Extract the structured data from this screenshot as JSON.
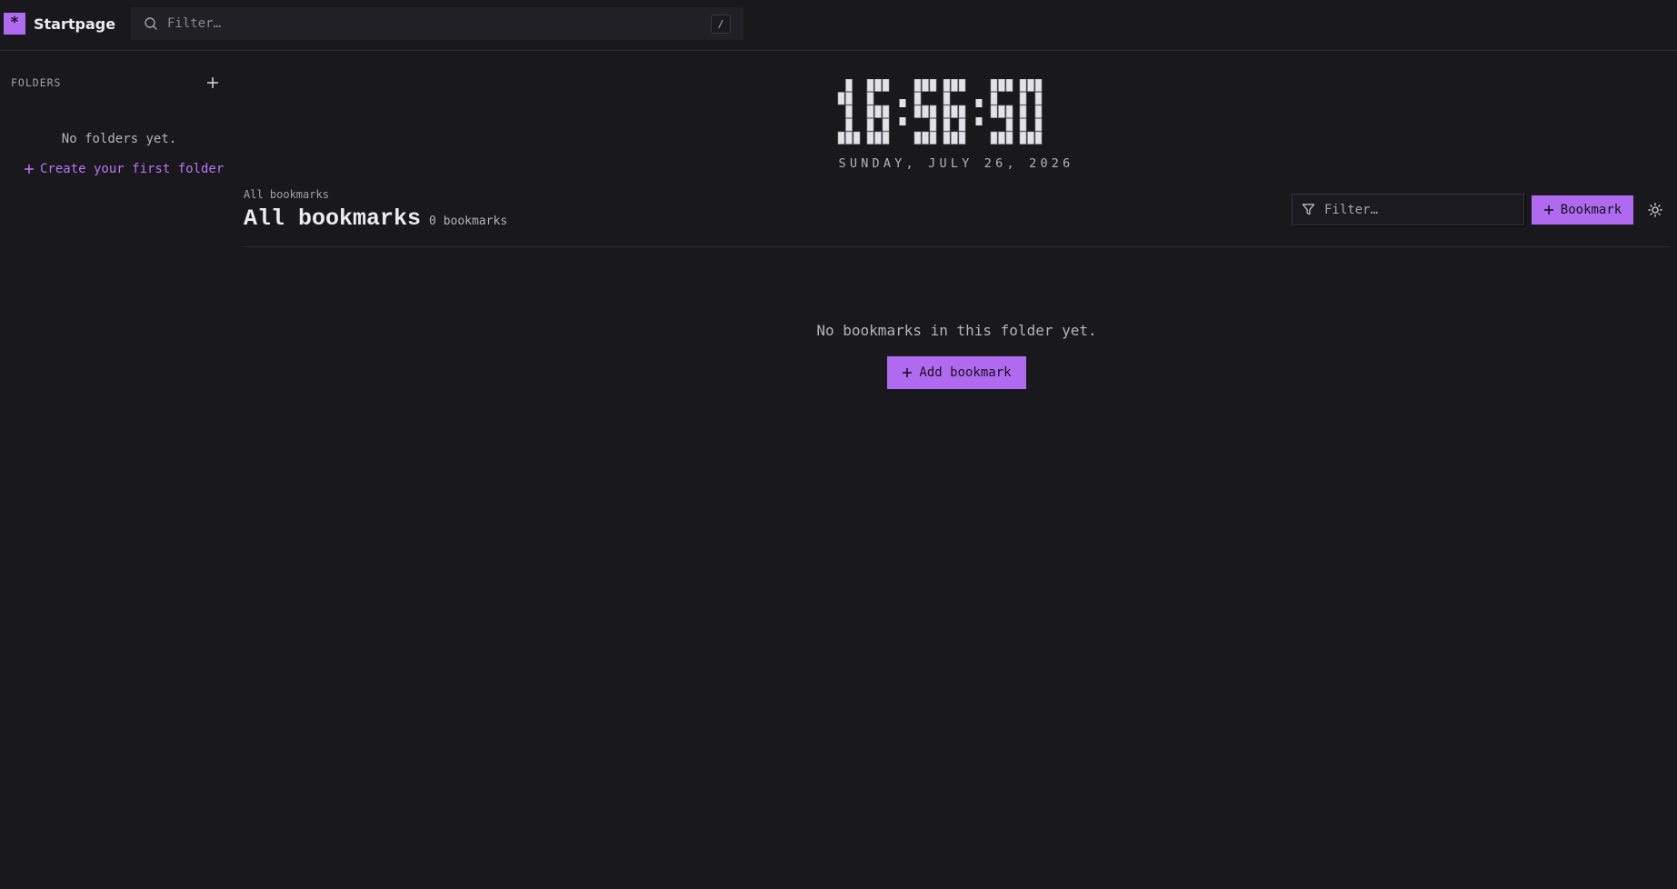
{
  "app": {
    "name": "Startpage",
    "logo_glyph": "*",
    "accent_color": "#b06af0"
  },
  "top_search": {
    "placeholder": "Filter…",
    "shortcut": "/",
    "icon": "search-icon"
  },
  "sidebar": {
    "section_label": "FOLDERS",
    "add_icon": "plus-icon",
    "empty_text": "No folders yet.",
    "create_link_label": "Create your first folder"
  },
  "clock": {
    "time": "16:56:50",
    "date": "SUNDAY, JULY 26, 2026"
  },
  "main": {
    "breadcrumb": "All bookmarks",
    "title": "All bookmarks",
    "count_label": "0 bookmarks",
    "filter_placeholder": "Filter…",
    "filter_icon": "filter-icon",
    "add_button_label": "Bookmark",
    "theme_icon": "sun-icon",
    "empty_text": "No bookmarks in this folder yet.",
    "empty_button_label": "Add bookmark"
  }
}
